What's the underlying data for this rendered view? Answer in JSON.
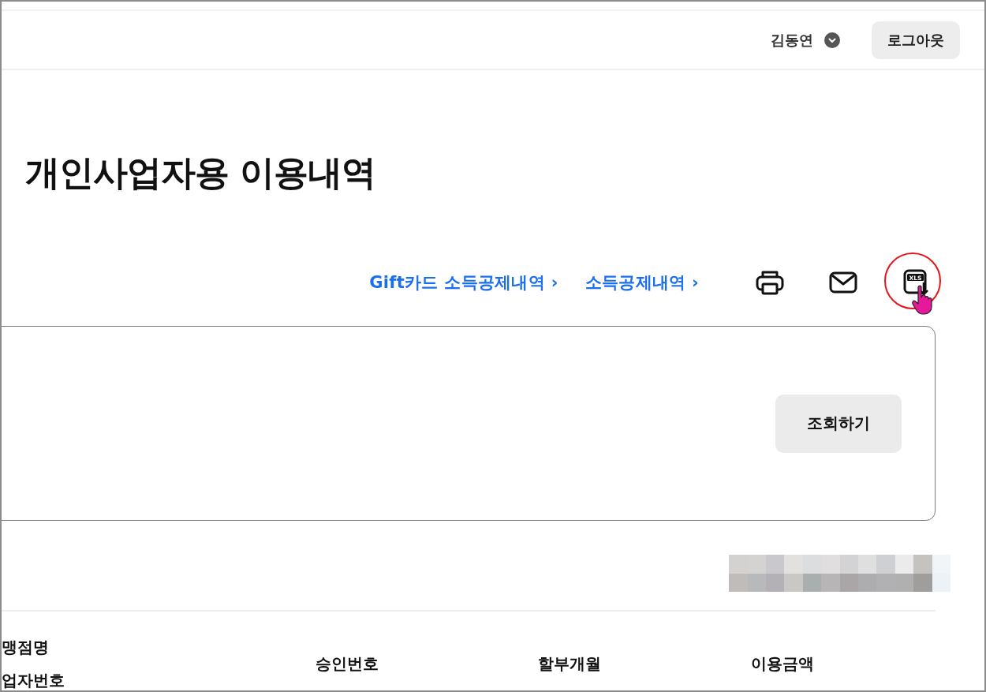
{
  "header": {
    "user_name": "김동연",
    "logout_button": "로그아웃"
  },
  "page_title": "개인사업자용 이용내역",
  "links": [
    {
      "label": "Gift카드 소득공제내역 ›"
    },
    {
      "label": "소득공제내역 ›"
    }
  ],
  "actions": [
    {
      "kind": "print",
      "annotated": false,
      "hovered": false
    },
    {
      "kind": "mail",
      "annotated": false,
      "hovered": false
    },
    {
      "kind": "excel",
      "label": "XLS",
      "annotated": true,
      "hovered": true
    }
  ],
  "search_panel": {
    "button": "조회하기"
  },
  "table": {
    "columns": [
      {
        "lines": [
          "맹점명",
          "업자번호"
        ]
      },
      {
        "lines": [
          "승인번호"
        ]
      },
      {
        "lines": [
          "할부개월"
        ]
      },
      {
        "lines": [
          "이용금액"
        ]
      }
    ]
  }
}
